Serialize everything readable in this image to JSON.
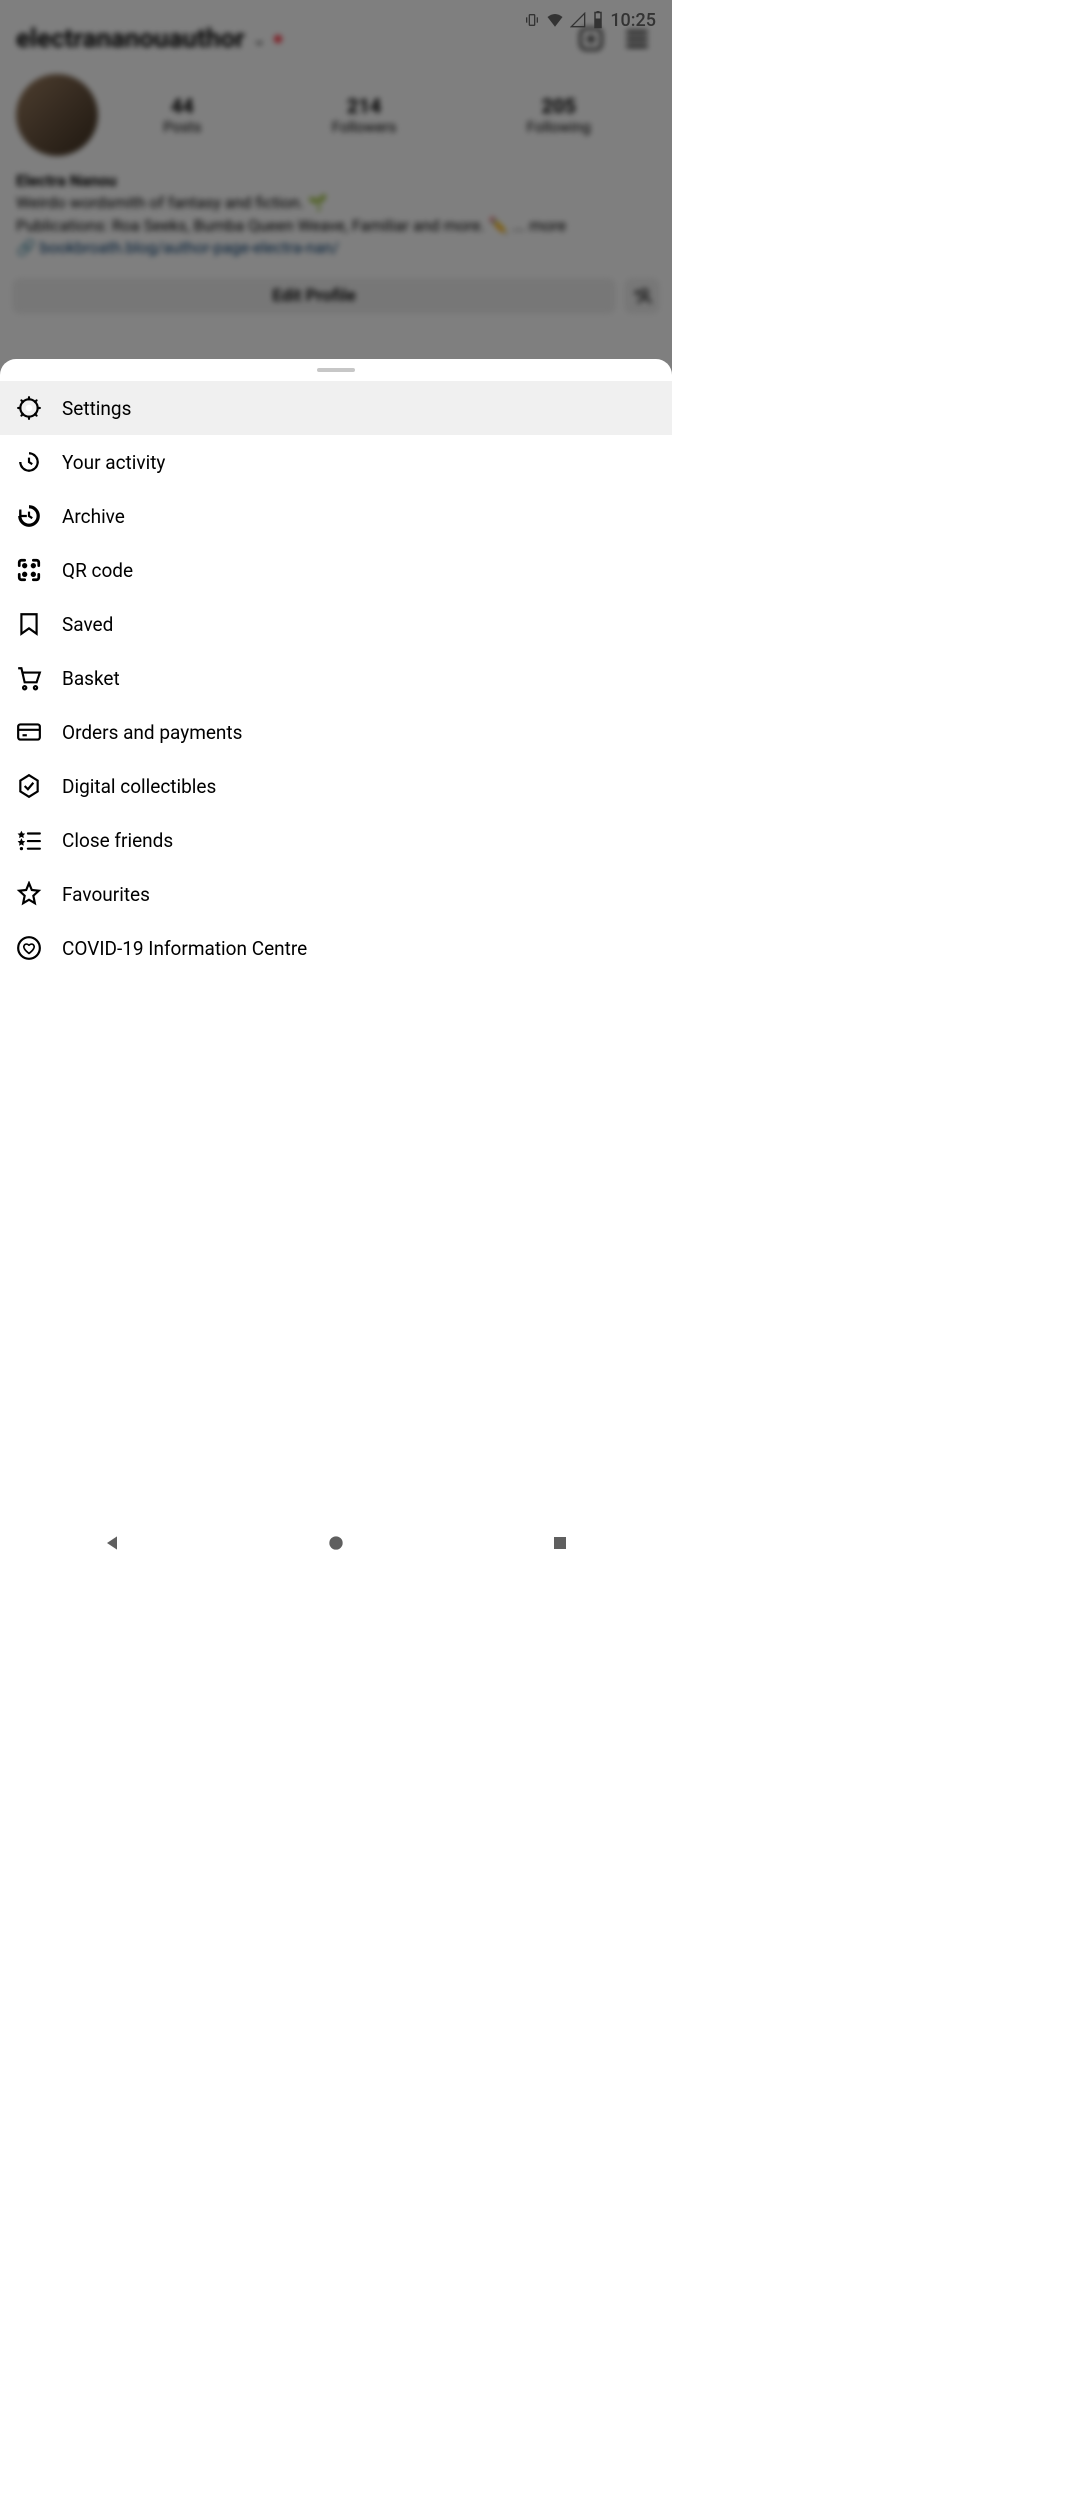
{
  "status_bar": {
    "time": "10:25"
  },
  "profile": {
    "username": "electrananouauthor",
    "display_name": "Electra Nanou",
    "bio_line1": "Weirdo wordsmith of fantasy and fiction. 🌱",
    "bio_line2": "Publications: Roa Seeks, Bumba Queen Weave, Familiar and more. ✏️",
    "bio_more": "... more",
    "link": "bookbroath.blog/author-page-electra-nan/",
    "stats": {
      "posts_count": "44",
      "posts_label": "Posts",
      "followers_count": "214",
      "followers_label": "Followers",
      "following_count": "205",
      "following_label": "Following"
    },
    "edit_button": "Edit Profile"
  },
  "menu": {
    "items": [
      {
        "label": "Settings",
        "icon": "gear"
      },
      {
        "label": "Your activity",
        "icon": "activity"
      },
      {
        "label": "Archive",
        "icon": "archive"
      },
      {
        "label": "QR code",
        "icon": "qr"
      },
      {
        "label": "Saved",
        "icon": "bookmark"
      },
      {
        "label": "Basket",
        "icon": "cart"
      },
      {
        "label": "Orders and payments",
        "icon": "card"
      },
      {
        "label": "Digital collectibles",
        "icon": "hexcheck"
      },
      {
        "label": "Close friends",
        "icon": "starlist"
      },
      {
        "label": "Favourites",
        "icon": "star"
      },
      {
        "label": "COVID-19 Information Centre",
        "icon": "heartcircle"
      }
    ]
  }
}
